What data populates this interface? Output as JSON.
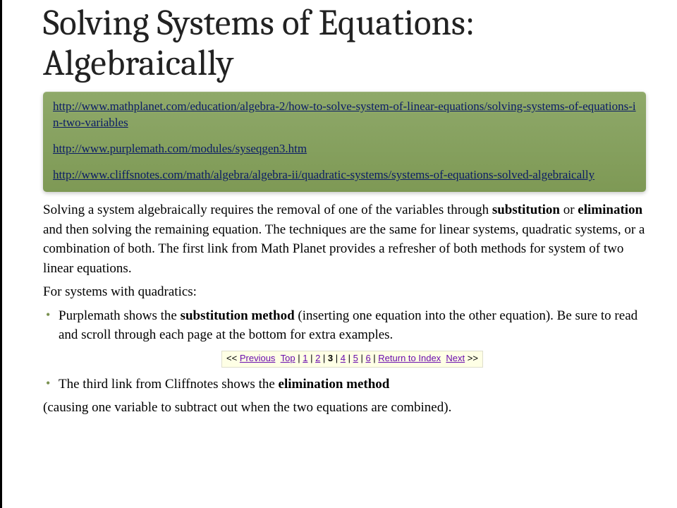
{
  "title": "Solving Systems of Equations: Algebraically",
  "links": {
    "l1": "http://www.mathplanet.com/education/algebra-2/how-to-solve-system-of-linear-equations/solving-systems-of-equations-in-two-variables",
    "l2": "http://www.purplemath.com/modules/syseqgen3.htm",
    "l3": "http://www.cliffsnotes.com/math/algebra/algebra-ii/quadratic-systems/systems-of-equations-solved-algebraically"
  },
  "body": {
    "p1a": "Solving a system algebraically requires the removal of one of the variables through ",
    "p1_b1": "substitution",
    "p1_mid": " or ",
    "p1_b2": "elimination",
    "p1b": " and then solving the remaining equation. The techniques are the same for linear systems, quadratic systems, or a combination of both. The first link from Math Planet provides a refresher of both methods for system of two linear equations.",
    "p2": " For systems with quadratics:",
    "li1a": "Purplemath shows the ",
    "li1_b": "substitution method",
    "li1b": " (inserting one equation into the other equation). Be sure to read and scroll through each page at the bottom for extra examples.",
    "li2a": "The third link from Cliffnotes shows the ",
    "li2_b": "elimination method",
    "p3": "(causing one variable to subtract out when the two equations are combined)."
  },
  "pager": {
    "prev_sym": "<< ",
    "prev": "Previous",
    "top": "Top",
    "nums": [
      "1",
      "2",
      "3",
      "4",
      "5",
      "6"
    ],
    "current_index": 2,
    "ret": "Return to Index",
    "next": "Next",
    "next_sym": " >>",
    "bar": " | "
  }
}
